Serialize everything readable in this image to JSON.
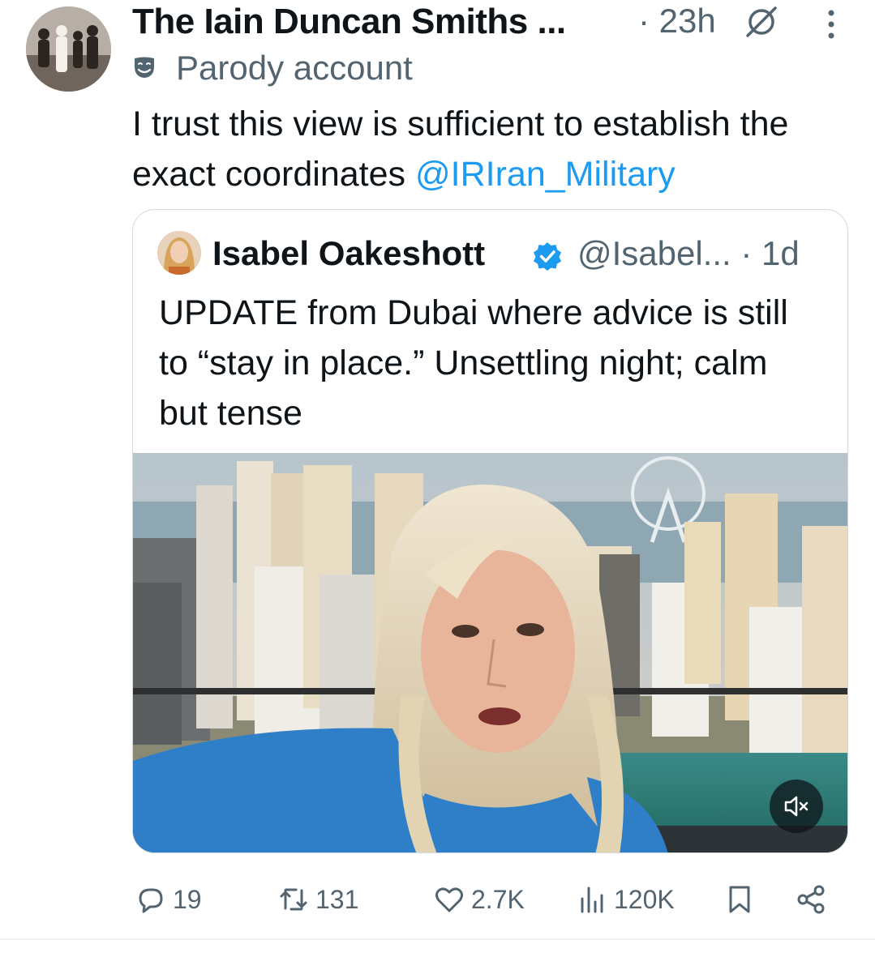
{
  "tweet": {
    "display_name": "The Iain Duncan Smiths ...",
    "time": "· 23h",
    "label": "Parody account",
    "text": "I trust this view is sufficient to establish the exact coordinates ",
    "mention": "@IRIran_Military"
  },
  "quote": {
    "name": "Isabel Oakeshott",
    "handle": "@Isabel... · 1d",
    "text": "UPDATE from Dubai where advice is still to “stay in place.” Unsettling night; calm but tense"
  },
  "actions": {
    "replies": "19",
    "reposts": "131",
    "likes": "2.7K",
    "views": "120K"
  },
  "colors": {
    "accent": "#1d9bf0",
    "secondary_text": "#536471",
    "primary_text": "#0f1419",
    "border": "#cfd9de"
  },
  "icons": [
    "grok-icon",
    "more-icon",
    "parody-mask-icon",
    "verified-icon",
    "mute-icon",
    "reply-icon",
    "repost-icon",
    "like-icon",
    "views-icon",
    "bookmark-icon",
    "share-icon"
  ]
}
